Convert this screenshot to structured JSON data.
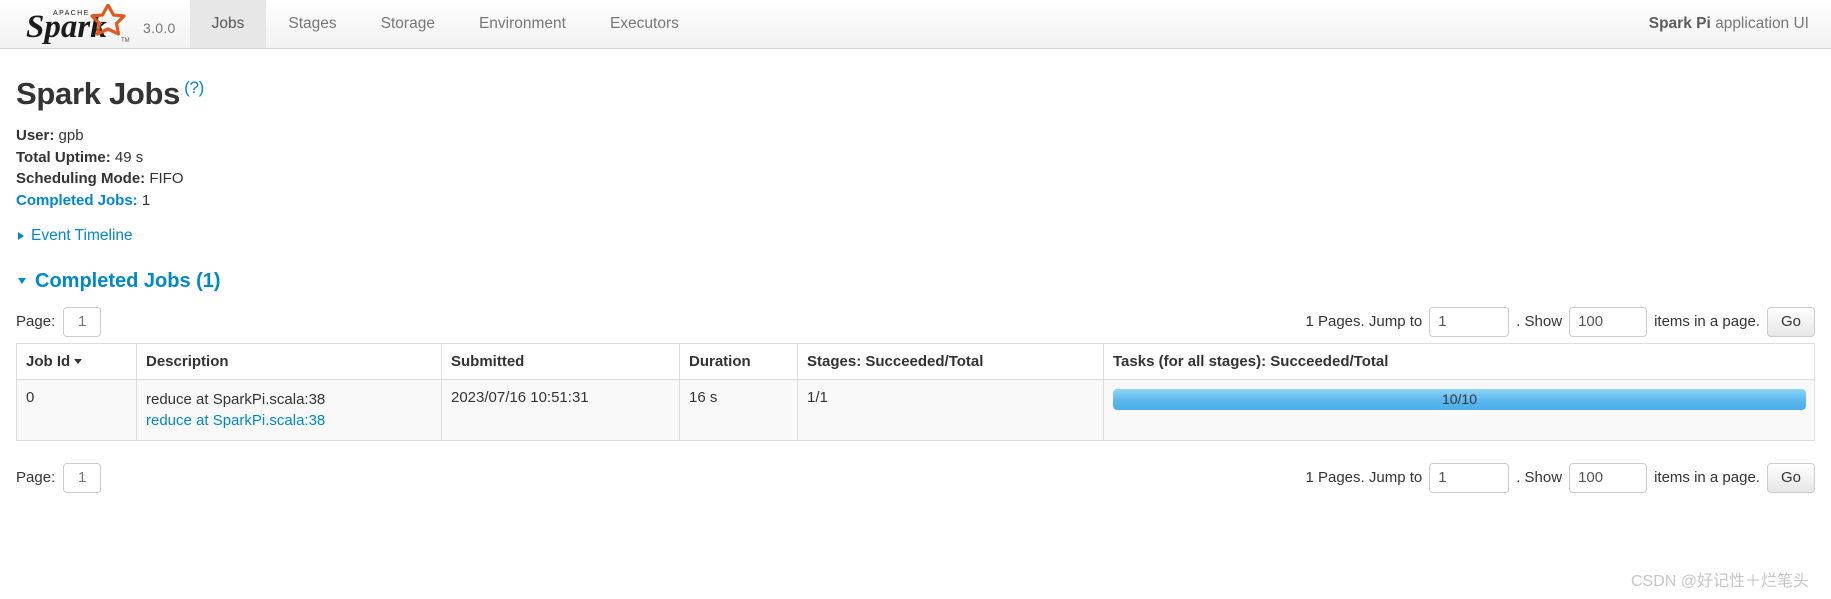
{
  "navbar": {
    "brand": {
      "logo_icon": "apache-spark-logo",
      "logo_text": "Spark",
      "logo_superscript": "APACHE",
      "version": "3.0.0"
    },
    "items": [
      {
        "label": "Jobs",
        "active": true
      },
      {
        "label": "Stages",
        "active": false
      },
      {
        "label": "Storage",
        "active": false
      },
      {
        "label": "Environment",
        "active": false
      },
      {
        "label": "Executors",
        "active": false
      }
    ],
    "app_name": "Spark Pi",
    "app_suffix": " application UI"
  },
  "page": {
    "title": "Spark Jobs",
    "help_label": "(?)",
    "summary": [
      {
        "label": "User:",
        "value": " gpb",
        "link": false
      },
      {
        "label": "Total Uptime:",
        "value": " 49 s",
        "link": false
      },
      {
        "label": "Scheduling Mode:",
        "value": " FIFO",
        "link": false
      },
      {
        "label": "Completed Jobs:",
        "value": " 1",
        "link": true
      }
    ],
    "event_timeline_label": "Event Timeline",
    "event_timeline_expanded": false,
    "completed_jobs_section": "Completed Jobs (1)",
    "completed_jobs_expanded": true
  },
  "pagination": {
    "page_label": "Page:",
    "current_page": "1",
    "pages_text": "1 Pages. Jump to",
    "jump_value": "1",
    "show_text": ". Show",
    "show_value": "100",
    "items_text": "items in a page.",
    "go_label": "Go"
  },
  "table": {
    "columns": [
      {
        "label": "Job Id",
        "sorted": true
      },
      {
        "label": "Description",
        "sorted": false
      },
      {
        "label": "Submitted",
        "sorted": false
      },
      {
        "label": "Duration",
        "sorted": false
      },
      {
        "label": "Stages: Succeeded/Total",
        "sorted": false
      },
      {
        "label": "Tasks (for all stages): Succeeded/Total",
        "sorted": false
      }
    ],
    "rows": [
      {
        "job_id": "0",
        "description": "reduce at SparkPi.scala:38",
        "description_link": "reduce at SparkPi.scala:38",
        "submitted": "2023/07/16 10:51:31",
        "duration": "16 s",
        "stages": "1/1",
        "tasks_text": "10/10",
        "tasks_percent": 100
      }
    ]
  },
  "colors": {
    "link": "#0088cc",
    "progress_fill": "#5bb8ee",
    "nav_active_bg": "#e7e7e7",
    "logo_star": "#e25a1c"
  },
  "watermark": "CSDN @好记性＋烂笔头"
}
